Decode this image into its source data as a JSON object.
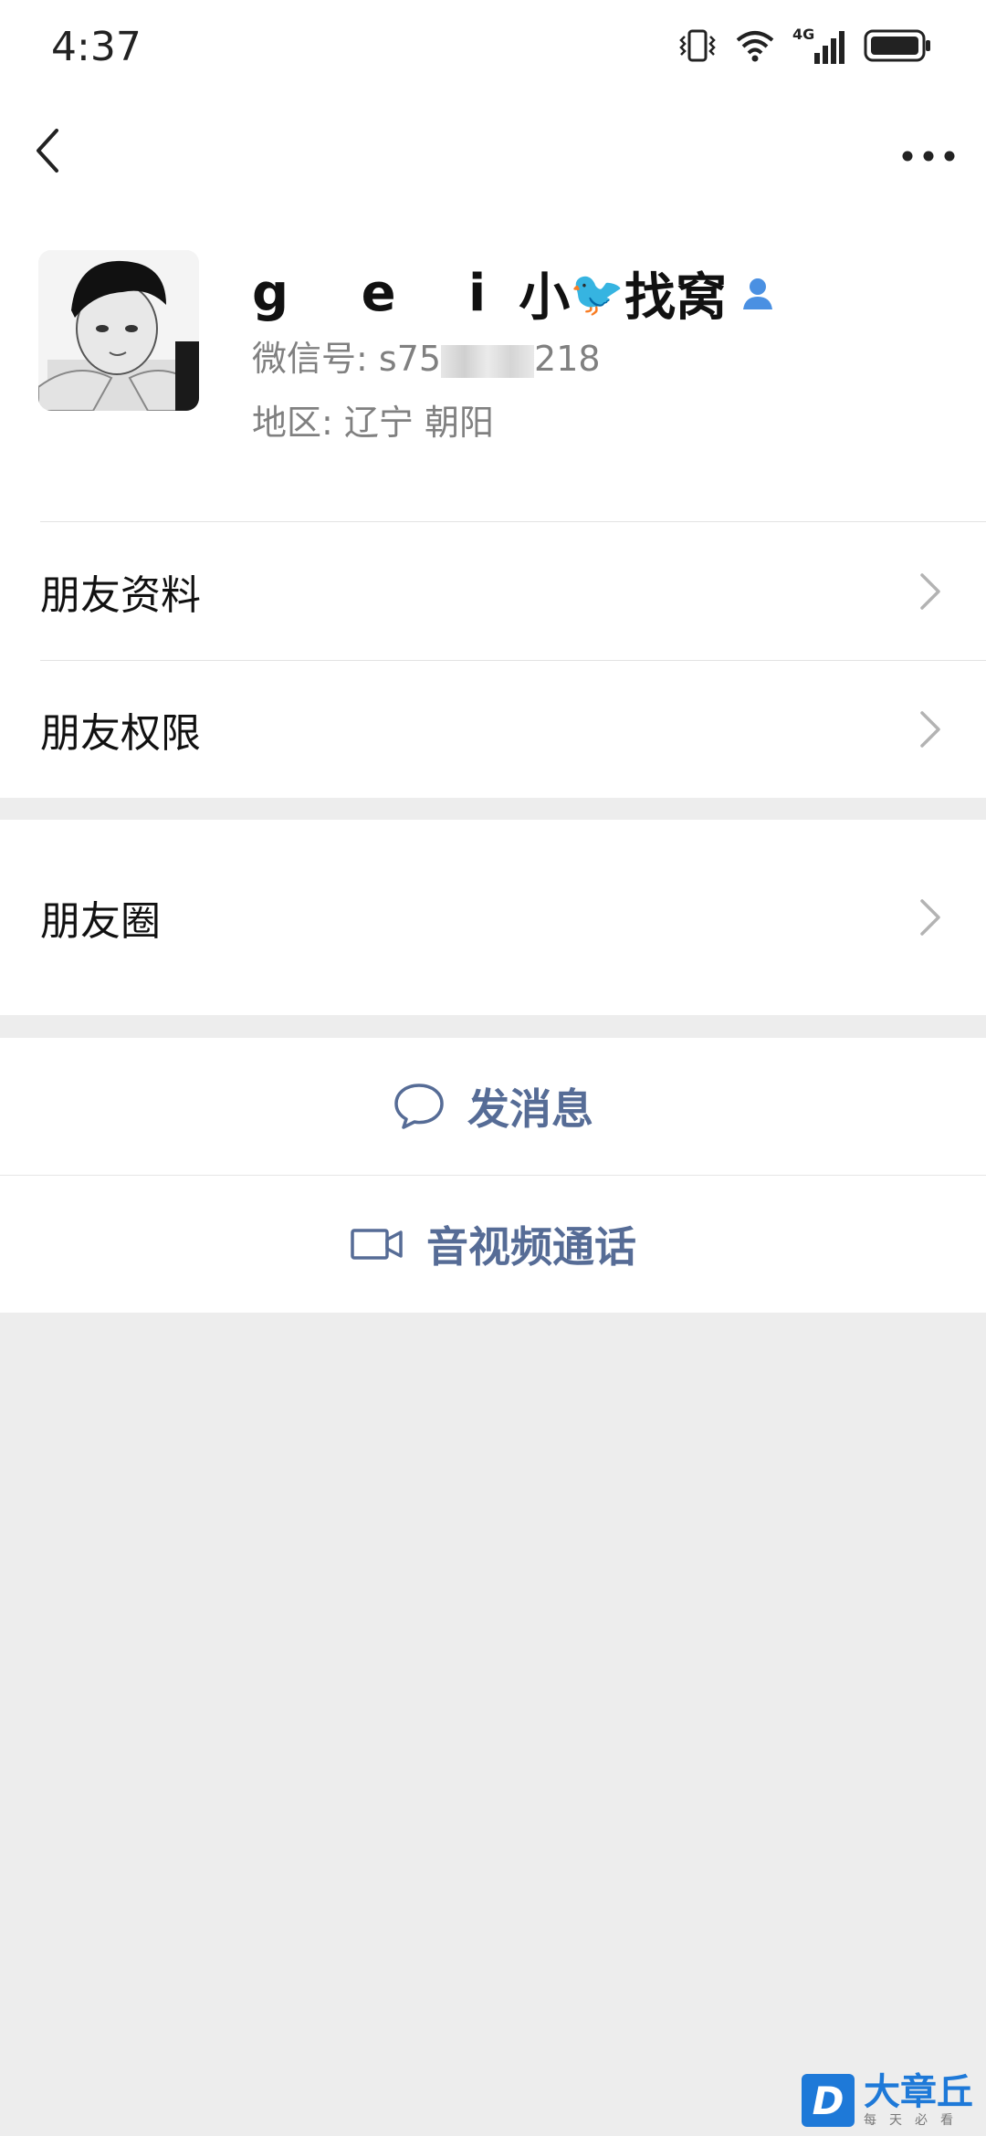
{
  "status_bar": {
    "time": "4:37",
    "network_label": "4G",
    "icons": [
      "vibrate-icon",
      "wifi-icon",
      "signal-icon",
      "battery-icon"
    ]
  },
  "top_bar": {
    "icons": [
      "back-chevron-icon",
      "more-dots-icon"
    ]
  },
  "profile": {
    "name_part1": "g e i",
    "name_part2": "小",
    "name_emoji": "🐦",
    "name_part3": "找窝",
    "id_label": "微信号: ",
    "id_visible_start": "s75",
    "id_visible_end": "218",
    "region_label": "地区: ",
    "region_value": "辽宁  朝阳",
    "avatar_icon": "avatar-photo"
  },
  "menu": {
    "items": [
      {
        "label": "朋友资料"
      },
      {
        "label": "朋友权限"
      },
      {
        "label": "朋友圈"
      }
    ]
  },
  "actions": {
    "message_label": "发消息",
    "call_label": "音视频通话"
  },
  "watermark": {
    "logo_letter": "D",
    "title": "大章丘",
    "subtitle": "每天必看"
  },
  "colors": {
    "link_blue": "#566c96",
    "background_gray": "#ededed",
    "verify_blue": "#4a90e2"
  }
}
